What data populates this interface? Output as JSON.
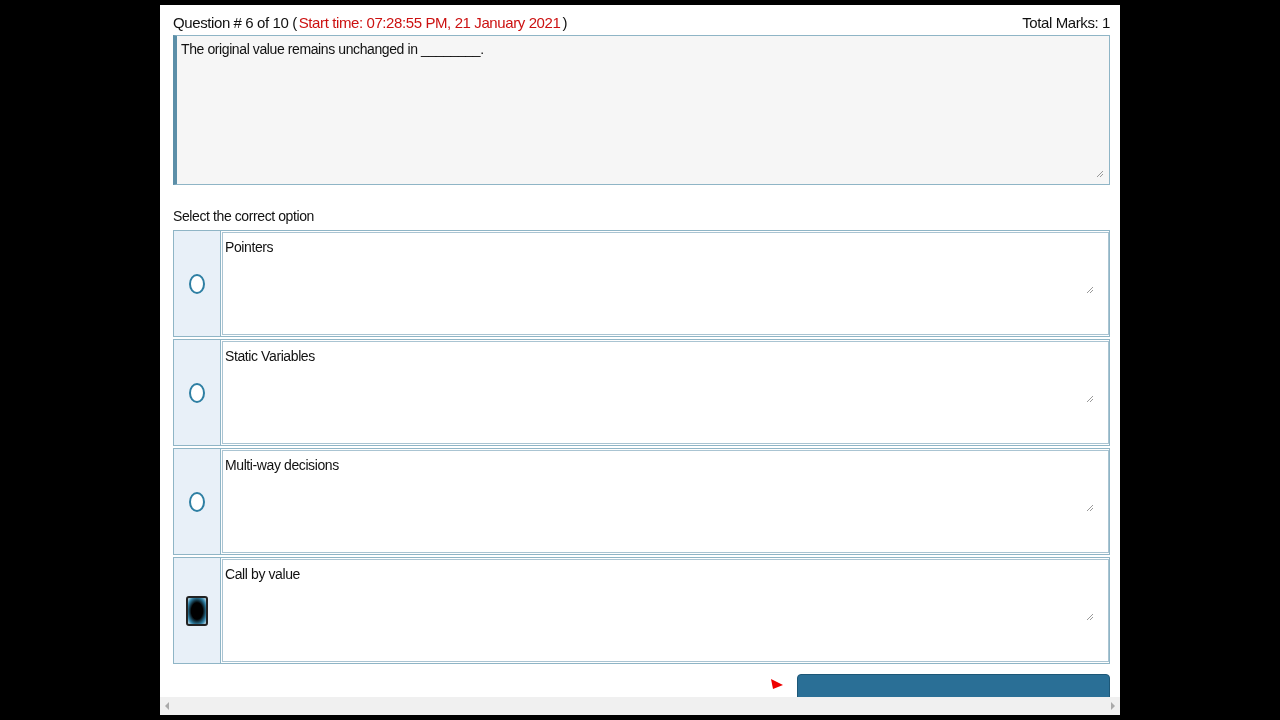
{
  "question": {
    "number": "Question # 6 of 10 (",
    "start_time": "Start time: 07:28:55 PM, 21 January 2021",
    "close": ")",
    "total_marks": "Total Marks: 1",
    "text": "The original value remains unchanged in ________."
  },
  "options_label": "Select the correct option",
  "options": [
    {
      "text": "Pointers",
      "selected": false
    },
    {
      "text": "Static Variables",
      "selected": false
    },
    {
      "text": "Multi-way decisions",
      "selected": false
    },
    {
      "text": "Call by value",
      "selected": true
    }
  ]
}
